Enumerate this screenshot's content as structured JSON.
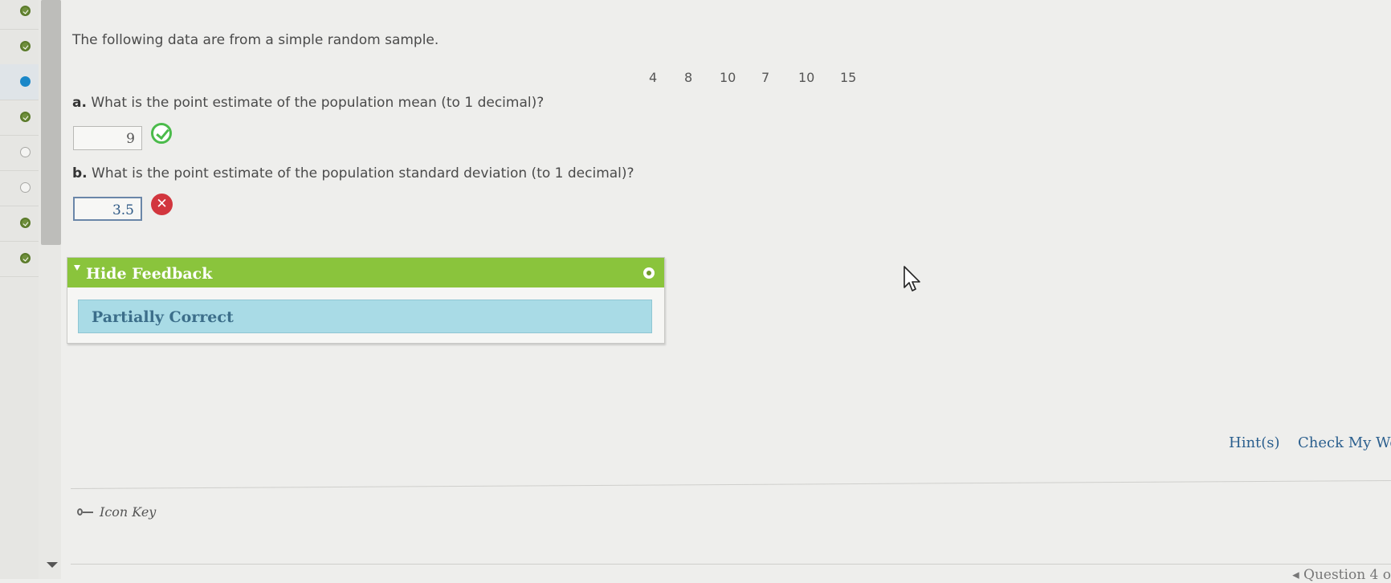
{
  "rail": {
    "items": [
      {
        "state": "done"
      },
      {
        "state": "done"
      },
      {
        "state": "current"
      },
      {
        "state": "done"
      },
      {
        "state": "empty"
      },
      {
        "state": "empty"
      },
      {
        "state": "done"
      },
      {
        "state": "done"
      }
    ]
  },
  "problem": {
    "intro": "The following data are from a simple random sample.",
    "data_values": [
      "4",
      "8",
      "10",
      "7",
      "10",
      "15"
    ],
    "part_a": {
      "letter": "a.",
      "prompt": "What is the point estimate of the population mean (to 1 decimal)?",
      "answer": "9",
      "status": "correct"
    },
    "part_b": {
      "letter": "b.",
      "prompt": "What is the point estimate of the population standard deviation (to 1 decimal)?",
      "answer": "3.5",
      "status": "incorrect"
    }
  },
  "feedback": {
    "toggle_label": "Hide Feedback",
    "status_text": "Partially Correct",
    "header_color": "#8ac43c",
    "body_color": "#a9dbe6"
  },
  "actions": {
    "hints_label": "Hint(s)",
    "check_label": "Check My Wo"
  },
  "footer": {
    "icon_key_label": "Icon Key",
    "question_nav_label": "Question 4 o"
  }
}
